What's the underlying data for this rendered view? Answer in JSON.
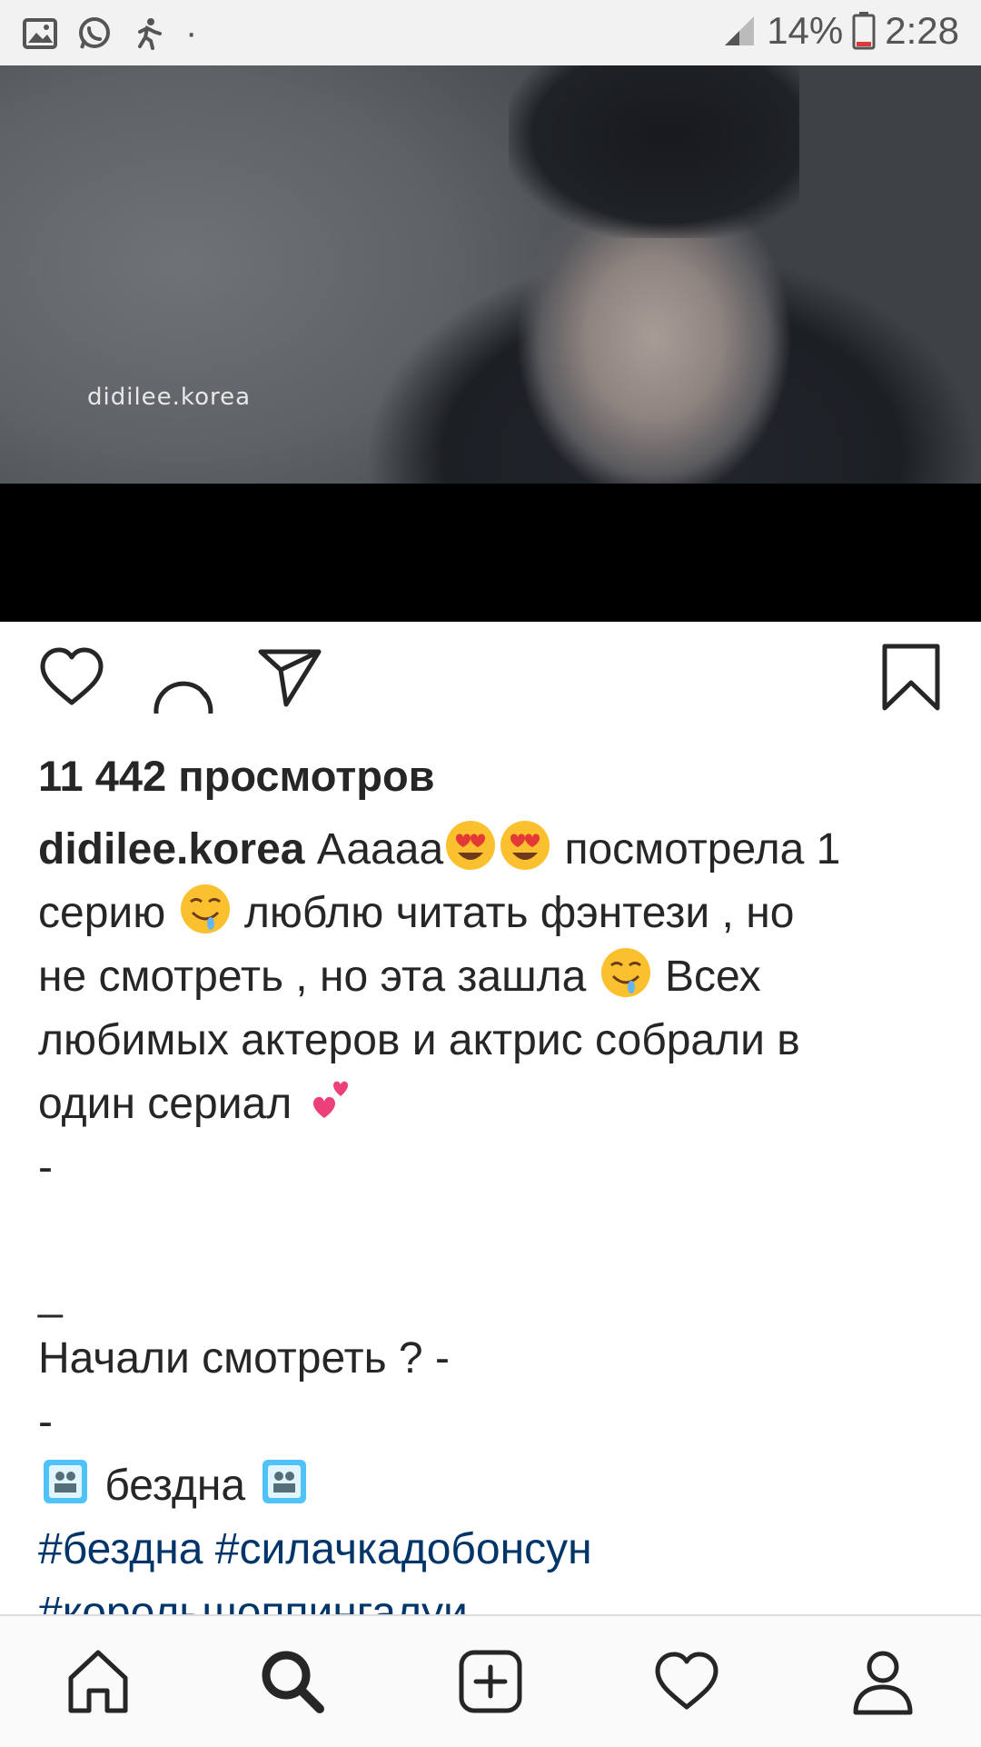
{
  "status_bar": {
    "battery_percent": "14%",
    "time": "2:28",
    "dot": "·",
    "icons": [
      "gallery-icon",
      "whatsapp-icon",
      "runner-notification-icon",
      "signal-icon",
      "battery-icon"
    ]
  },
  "media": {
    "watermark": "didilee.korea"
  },
  "actions": {
    "icons": [
      "heart-icon",
      "comment-icon",
      "share-icon",
      "bookmark-icon"
    ]
  },
  "post": {
    "views": "11 442 просмотров",
    "username": "didilee.korea",
    "caption_line1": " Ааааа",
    "caption_line1_tail": " посмотрела 1",
    "caption_line2_a": "серию ",
    "caption_line2_b": " люблю читать фэнтези , но",
    "caption_line3_a": "не смотреть , но эта зашла ",
    "caption_line3_b": " Всех",
    "caption_line4": "любимых актеров и актрис собрали в",
    "caption_line5": "один сериал ",
    "dash1": "-",
    "dash2": "_",
    "question": "Начали смотреть ? -",
    "dash3": "-",
    "title_tag": " бездна ",
    "hashtags_line1": "#бездна #силачкадобонсун",
    "hashtags_line2": "#корольшоппингалуи",
    "emojis": [
      "heart-eyes-emoji",
      "drooling-face-emoji",
      "two-hearts-emoji",
      "movie-camera-emoji"
    ]
  },
  "bottom_nav": {
    "items": [
      "home-icon",
      "search-icon",
      "add-post-icon",
      "activity-heart-icon",
      "profile-icon"
    ]
  }
}
